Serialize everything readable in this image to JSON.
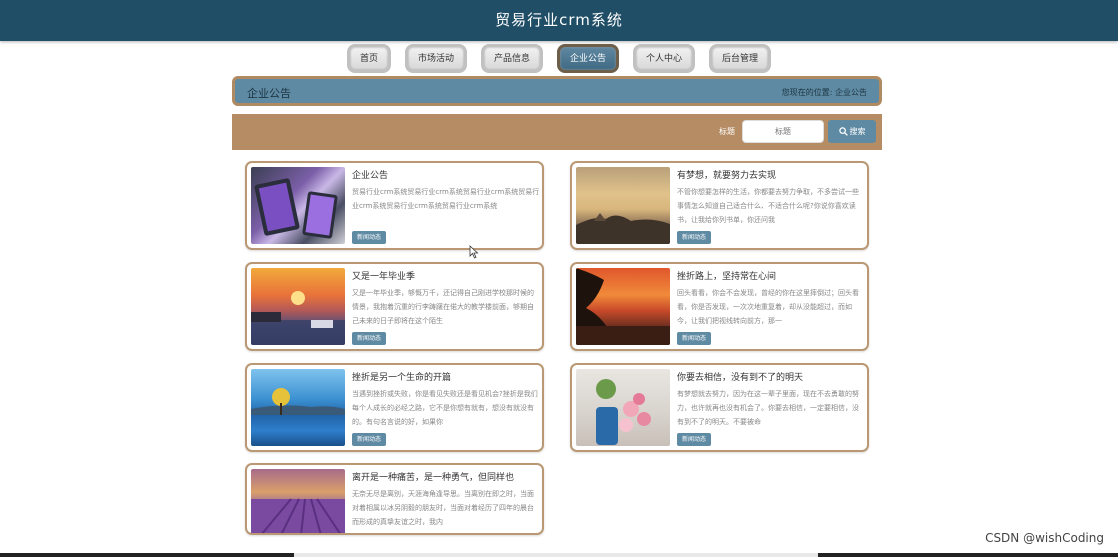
{
  "header": {
    "title": "贸易行业crm系统"
  },
  "nav": {
    "items": [
      {
        "label": "首页",
        "active": false
      },
      {
        "label": "市场活动",
        "active": false
      },
      {
        "label": "产品信息",
        "active": false
      },
      {
        "label": "企业公告",
        "active": true
      },
      {
        "label": "个人中心",
        "active": false
      },
      {
        "label": "后台管理",
        "active": false
      }
    ]
  },
  "breadcrumb": {
    "title": "企业公告",
    "location_label": "您现在的位置:",
    "location_value": "企业公告"
  },
  "search": {
    "label": "标题",
    "placeholder": "标题",
    "button_label": "搜索"
  },
  "cards": [
    {
      "title": "企业公告",
      "desc": "贸易行业crm系统贸易行业crm系统贸易行业crm系统贸易行业crm系统贸易行业crm系统贸易行业crm系统",
      "tag": "新闻动态"
    },
    {
      "title": "有梦想，就要努力去实现",
      "desc": "不管你想要怎样的生活，你都要去努力争取，不多尝试一些事情怎么知道自己适合什么、不适合什么呢?你说你喜欢读书，让我给你列书单，你还问我",
      "tag": "新闻动态"
    },
    {
      "title": "又是一年毕业季",
      "desc": "又是一年毕业季，够慨万千，还记得自己刚进学校那时候的情景，我抱着沉重的行李踌躇在偌大的教学楼前面，够期自己未来的日子即将在这个陌生",
      "tag": "新闻动态"
    },
    {
      "title": "挫折路上，坚持常在心间",
      "desc": "回头看看，你会不会发现，曾经的你在这里摔倒过；回头看看，你是否发现，一次次地重复着，却从没能超过，而如今，让我们把视线转向前方，那一",
      "tag": "新闻动态"
    },
    {
      "title": "挫折是另一个生命的开篇",
      "desc": "当遇到挫折或失败，你是看见失败还是看见机会?挫折是我们每个人成长的必经之路，它不是你想有就有，想没有就没有的。有句名言说的好，如果你",
      "tag": "新闻动态"
    },
    {
      "title": "你要去相信，没有到不了的明天",
      "desc": "有梦想就去努力，因为在这一辈子里面，现在不去勇敢的努力，也许就再也没有机会了。你要去相信，一定要相信，没有到不了的明天。不要被命",
      "tag": "新闻动态"
    },
    {
      "title": "离开是一种痛苦，是一种勇气，但同样也",
      "desc": "无奈无尽是离别，天涯海角逢导思。当离别在即之时，当面对着相属以冰另阴毅的朋友时，当面对着经历了四年的晨台而形成的真挚友谊之时，我内",
      "tag": "新闻动态"
    }
  ],
  "watermark": "CSDN @wishCoding",
  "colors": {
    "header_bg": "#1f4e66",
    "accent_blue": "#5f8aa3",
    "accent_tan": "#b58c64",
    "card_border": "#b99873"
  }
}
